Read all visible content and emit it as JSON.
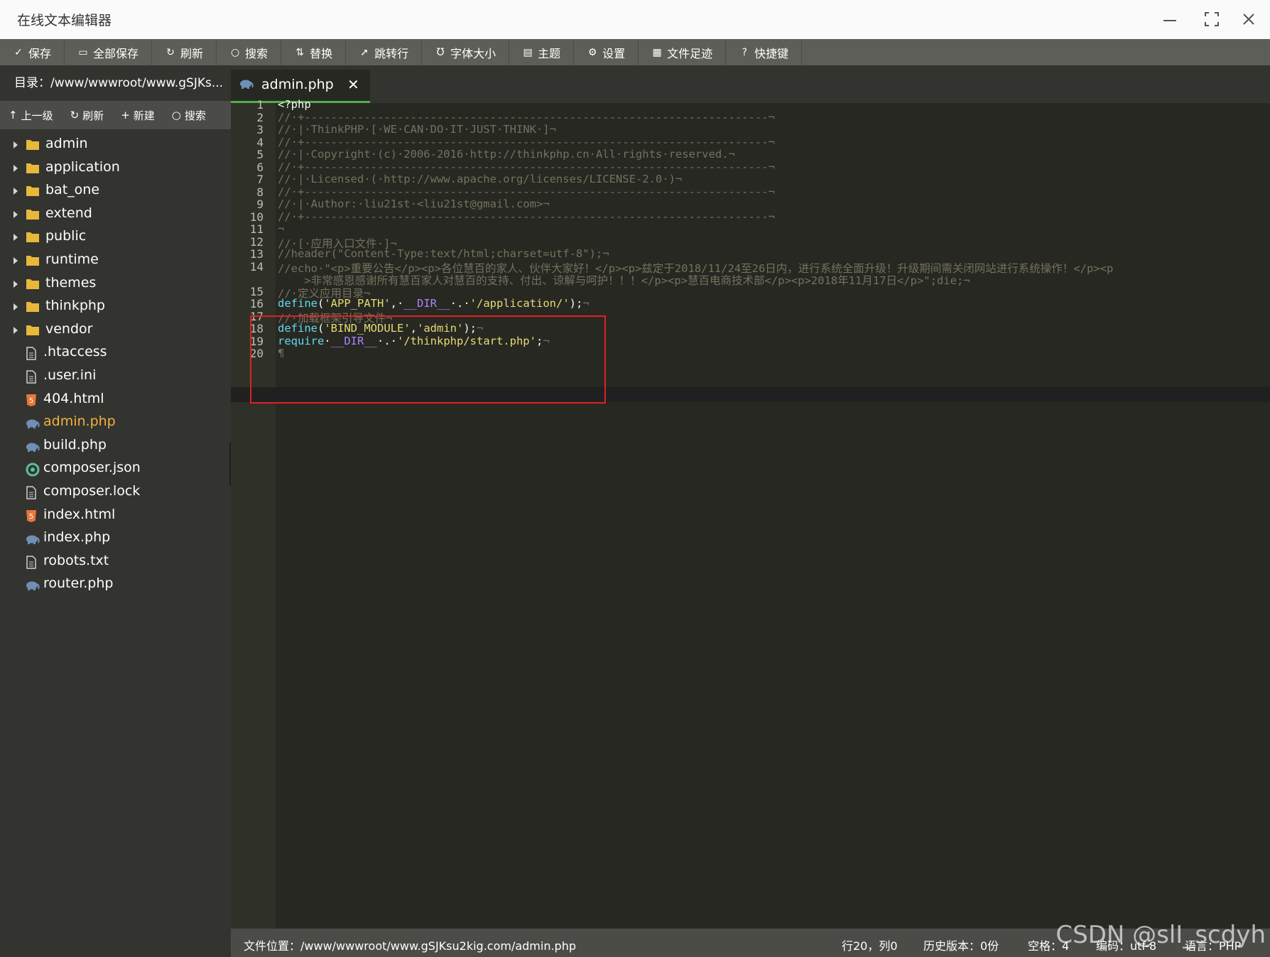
{
  "window": {
    "title": "在线文本编辑器"
  },
  "toolbar": [
    {
      "icon": "save-icon",
      "glyph": "✓",
      "label": "保存"
    },
    {
      "icon": "save-all-icon",
      "glyph": "▭",
      "label": "全部保存"
    },
    {
      "icon": "refresh-icon",
      "glyph": "↻",
      "label": "刷新"
    },
    {
      "icon": "search-icon",
      "glyph": "○",
      "label": "搜索"
    },
    {
      "icon": "replace-icon",
      "glyph": "⇅",
      "label": "替换"
    },
    {
      "icon": "goto-line-icon",
      "glyph": "➚",
      "label": "跳转行"
    },
    {
      "icon": "font-size-icon",
      "glyph": "Ʊ",
      "label": "字体大小"
    },
    {
      "icon": "theme-icon",
      "glyph": "▤",
      "label": "主题"
    },
    {
      "icon": "settings-icon",
      "glyph": "⚙",
      "label": "设置"
    },
    {
      "icon": "file-history-icon",
      "glyph": "▦",
      "label": "文件足迹"
    },
    {
      "icon": "shortcut-icon",
      "glyph": "?",
      "label": "快捷键"
    }
  ],
  "sidebar": {
    "dir_label": "目录：/www/wwwroot/www.gSJKs...",
    "tools": [
      {
        "icon": "up-arrow-icon",
        "glyph": "↑",
        "label": "上一级"
      },
      {
        "icon": "refresh-icon",
        "glyph": "↻",
        "label": "刷新"
      },
      {
        "icon": "plus-icon",
        "glyph": "+",
        "label": "新建"
      },
      {
        "icon": "search-icon",
        "glyph": "○",
        "label": "搜索"
      }
    ],
    "items": [
      {
        "name": "admin",
        "type": "folder"
      },
      {
        "name": "application",
        "type": "folder"
      },
      {
        "name": "bat_one",
        "type": "folder"
      },
      {
        "name": "extend",
        "type": "folder"
      },
      {
        "name": "public",
        "type": "folder"
      },
      {
        "name": "runtime",
        "type": "folder"
      },
      {
        "name": "themes",
        "type": "folder"
      },
      {
        "name": "thinkphp",
        "type": "folder"
      },
      {
        "name": "vendor",
        "type": "folder"
      },
      {
        "name": ".htaccess",
        "type": "text"
      },
      {
        "name": ".user.ini",
        "type": "text"
      },
      {
        "name": "404.html",
        "type": "html"
      },
      {
        "name": "admin.php",
        "type": "php",
        "active": true
      },
      {
        "name": "build.php",
        "type": "php"
      },
      {
        "name": "composer.json",
        "type": "json"
      },
      {
        "name": "composer.lock",
        "type": "text"
      },
      {
        "name": "index.html",
        "type": "html"
      },
      {
        "name": "index.php",
        "type": "php"
      },
      {
        "name": "robots.txt",
        "type": "text"
      },
      {
        "name": "router.php",
        "type": "php"
      }
    ]
  },
  "tab": {
    "label": "admin.php",
    "close": "✕"
  },
  "code_lines": [
    {
      "n": "1",
      "segs": [
        [
          "p",
          "<?php"
        ]
      ]
    },
    {
      "n": "2",
      "segs": [
        [
          "c",
          "//·+----------------------------------------------------------------------¬"
        ]
      ]
    },
    {
      "n": "3",
      "segs": [
        [
          "c",
          "//·|·ThinkPHP·[·WE·CAN·DO·IT·JUST·THINK·]¬"
        ]
      ]
    },
    {
      "n": "4",
      "segs": [
        [
          "c",
          "//·+----------------------------------------------------------------------¬"
        ]
      ]
    },
    {
      "n": "5",
      "segs": [
        [
          "c",
          "//·|·Copyright·(c)·2006-2016·http://thinkphp.cn·All·rights·reserved.¬"
        ]
      ]
    },
    {
      "n": "6",
      "segs": [
        [
          "c",
          "//·+----------------------------------------------------------------------¬"
        ]
      ]
    },
    {
      "n": "7",
      "segs": [
        [
          "c",
          "//·|·Licensed·(·http://www.apache.org/licenses/LICENSE-2.0·)¬"
        ]
      ]
    },
    {
      "n": "8",
      "segs": [
        [
          "c",
          "//·+----------------------------------------------------------------------¬"
        ]
      ]
    },
    {
      "n": "9",
      "segs": [
        [
          "c",
          "//·|·Author:·liu21st·<liu21st@gmail.com>¬"
        ]
      ]
    },
    {
      "n": "10",
      "segs": [
        [
          "c",
          "//·+----------------------------------------------------------------------¬"
        ]
      ]
    },
    {
      "n": "11",
      "segs": [
        [
          "c",
          "¬"
        ]
      ]
    },
    {
      "n": "12",
      "segs": [
        [
          "c",
          "//·[·应用入口文件·]¬"
        ]
      ]
    },
    {
      "n": "13",
      "segs": [
        [
          "c",
          "//header(\"Content-Type:text/html;charset=utf-8\");¬"
        ]
      ]
    },
    {
      "n": "14",
      "segs": [
        [
          "c",
          "//echo·\"<p>重要公告</p><p>各位慧百的家人、伙伴大家好！</p><p>兹定于2018/11/24至26日内，进行系统全面升级！升级期间需关闭网站进行系统操作！</p><p"
        ]
      ]
    },
    {
      "n": "",
      "segs": [
        [
          "c",
          "    >非常感恩感谢所有慧百家人对慧百的支持、付出、谅解与呵护！！！</p><p>慧百电商技术部</p><p>2018年11月17日</p>\";die;¬"
        ]
      ]
    },
    {
      "n": "15",
      "segs": [
        [
          "c",
          "//·定义应用目录¬"
        ]
      ]
    },
    {
      "n": "16",
      "segs": [
        [
          "f",
          "define"
        ],
        [
          "p",
          "("
        ],
        [
          "s",
          "'APP_PATH'"
        ],
        [
          "p",
          ",·"
        ],
        [
          "k",
          "__DIR__"
        ],
        [
          "p",
          "·.·"
        ],
        [
          "s",
          "'/application/'"
        ],
        [
          "p",
          ");"
        ],
        [
          "c",
          "¬"
        ]
      ]
    },
    {
      "n": "17",
      "segs": [
        [
          "c",
          "//·加载框架引导文件¬"
        ]
      ]
    },
    {
      "n": "18",
      "segs": [
        [
          "f",
          "define"
        ],
        [
          "p",
          "("
        ],
        [
          "s",
          "'BIND_MODULE'"
        ],
        [
          "p",
          ","
        ],
        [
          "s",
          "'admin'"
        ],
        [
          "p",
          ");"
        ],
        [
          "c",
          "¬"
        ]
      ]
    },
    {
      "n": "19",
      "segs": [
        [
          "f",
          "require"
        ],
        [
          "p",
          "·"
        ],
        [
          "k",
          "__DIR__"
        ],
        [
          "p",
          "·.·"
        ],
        [
          "s",
          "'/thinkphp/start.php'"
        ],
        [
          "p",
          ";"
        ],
        [
          "c",
          "¬"
        ]
      ]
    },
    {
      "n": "20",
      "segs": [
        [
          "c",
          "¶"
        ]
      ]
    }
  ],
  "status": {
    "file_location": "文件位置：/www/wwwroot/www.gSJKsu2kig.com/admin.php",
    "cursor": "行20，列0",
    "history": "历史版本：0份",
    "indent": "空格：4",
    "encoding": "编码：utf-8",
    "language": "语言：PHP"
  },
  "watermark": "CSDN @slI_scdyh",
  "colors": {
    "accent": "#4fae4f",
    "highlight_box": "#e02020",
    "active_file": "#f2b03c"
  }
}
